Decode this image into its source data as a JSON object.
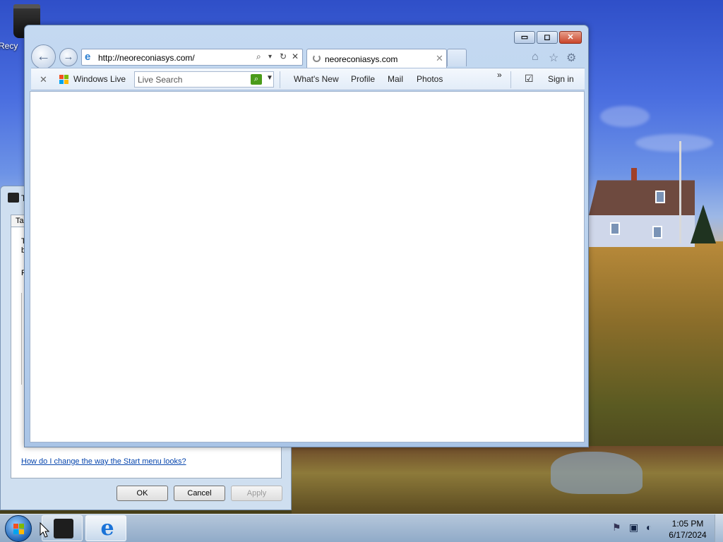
{
  "desktop": {
    "recycle_bin_label": "Recy"
  },
  "background_dialog": {
    "title_partial": "T",
    "tab_partial": "Ta",
    "text_line1": "T",
    "text_line2": "b",
    "text_line3": "P",
    "help_link": "How do I change the way the Start menu looks?",
    "ok_label": "OK",
    "cancel_label": "Cancel",
    "apply_label": "Apply"
  },
  "browser": {
    "address_url": "http://neoreconiasys.com/",
    "tab_title": "neoreconiasys.com",
    "tab_close": "✕",
    "caption_min": "▭",
    "caption_max": "◻",
    "caption_close": "✕",
    "back_glyph": "←",
    "fwd_glyph": "→",
    "search_glyph": "⌕",
    "search_dropdown_glyph": "▾",
    "refresh_glyph": "↻",
    "stop_glyph": "✕",
    "home_glyph": "⌂",
    "favorites_glyph": "☆",
    "tools_glyph": "⚙",
    "linkbar": {
      "close_glyph": "✕",
      "windows_live_label": "Windows Live",
      "search_placeholder": "Live Search",
      "search_go_glyph": "⌕",
      "search_dd_glyph": "▼",
      "links": [
        "What's New",
        "Profile",
        "Mail",
        "Photos"
      ],
      "more_glyph": "»",
      "checkbox_glyph": "☑",
      "sign_in_label": "Sign in"
    }
  },
  "taskbar": {
    "ie_glyph": "e",
    "time": "1:05 PM",
    "date": "6/17/2024"
  },
  "colors": {
    "accent": "#1f63b5",
    "link": "#0645ad",
    "search_go": "#4a9b1a",
    "close_red": "#c9452b"
  }
}
